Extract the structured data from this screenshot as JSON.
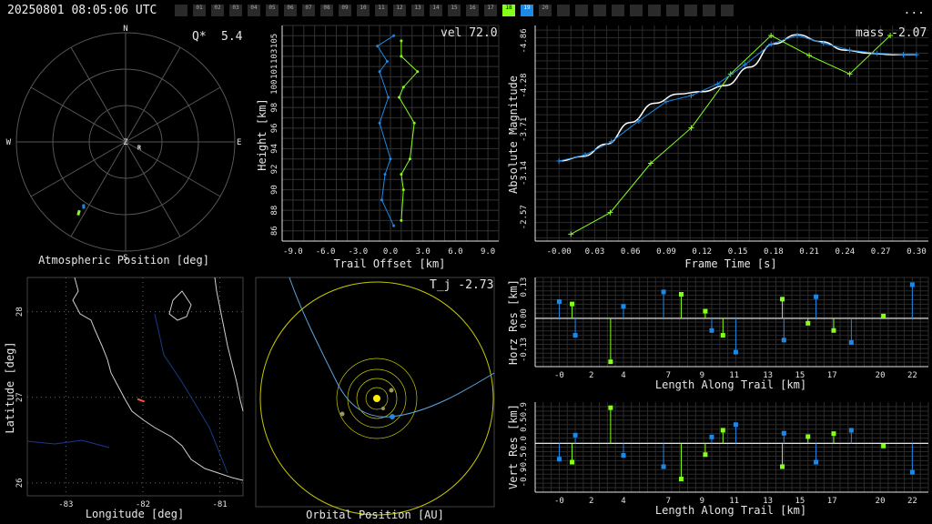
{
  "header": {
    "timestamp": "20250801 08:05:06 UTC",
    "cameras": [
      {
        "id": "",
        "state": "off"
      },
      {
        "id": "01",
        "state": "off"
      },
      {
        "id": "02",
        "state": "off"
      },
      {
        "id": "03",
        "state": "off"
      },
      {
        "id": "04",
        "state": "off"
      },
      {
        "id": "05",
        "state": "off"
      },
      {
        "id": "06",
        "state": "off"
      },
      {
        "id": "07",
        "state": "off"
      },
      {
        "id": "08",
        "state": "off"
      },
      {
        "id": "09",
        "state": "off"
      },
      {
        "id": "10",
        "state": "off"
      },
      {
        "id": "11",
        "state": "off"
      },
      {
        "id": "12",
        "state": "off"
      },
      {
        "id": "13",
        "state": "off"
      },
      {
        "id": "14",
        "state": "off"
      },
      {
        "id": "15",
        "state": "off"
      },
      {
        "id": "16",
        "state": "off"
      },
      {
        "id": "17",
        "state": "off"
      },
      {
        "id": "18",
        "state": "green"
      },
      {
        "id": "19",
        "state": "blue"
      },
      {
        "id": "20",
        "state": "off"
      },
      {
        "id": "",
        "state": "off"
      },
      {
        "id": "",
        "state": "off"
      },
      {
        "id": "",
        "state": "off"
      },
      {
        "id": "",
        "state": "off"
      },
      {
        "id": "",
        "state": "off"
      },
      {
        "id": "",
        "state": "off"
      },
      {
        "id": "",
        "state": "off"
      },
      {
        "id": "",
        "state": "off"
      },
      {
        "id": "",
        "state": "off"
      },
      {
        "id": "",
        "state": "off"
      }
    ],
    "menu_label": "..."
  },
  "colors": {
    "station1": "#86ff1a",
    "station2": "#1e88e5",
    "grid": "#555555",
    "axis": "#e6e6e6",
    "fit": "#ffffff",
    "orbit_ring": "#c8c800",
    "sun": "#ffee00"
  },
  "chart_data": [
    {
      "id": "polar",
      "type": "scatter",
      "title": "Atmospheric Position [deg]",
      "annotation_label": "Q*",
      "annotation_value": "5.4",
      "directions": [
        "N",
        "E",
        "S",
        "W",
        "Z"
      ],
      "radiant_label": "R",
      "radiant": {
        "az": 110,
        "zen": 12
      },
      "series": [
        {
          "station": 1,
          "points": [
            {
              "az": 213,
              "zen": 72
            },
            {
              "az": 214,
              "zen": 68
            }
          ]
        },
        {
          "station": 2,
          "points": [
            {
              "az": 212,
              "zen": 65
            },
            {
              "az": 214,
              "zen": 62
            }
          ]
        }
      ]
    },
    {
      "id": "trail",
      "type": "line",
      "annotation": "vel 72.0",
      "xlabel": "Trail Offset [km]",
      "ylabel": "Height [km]",
      "xlim": [
        -10,
        10
      ],
      "ylim": [
        85,
        106
      ],
      "xticks": [
        "-9.0",
        "-6.0",
        "-3.0",
        "0.0",
        "3.0",
        "6.0",
        "9.0"
      ],
      "yticks": [
        "86",
        "88",
        "90",
        "92",
        "94",
        "96",
        "98",
        "100",
        "101",
        "103",
        "105"
      ],
      "series": [
        {
          "station": 1,
          "x": [
            1.0,
            1.2,
            1.0,
            1.8,
            2.2,
            0.8,
            1.2,
            2.5,
            1.0,
            1.0
          ],
          "y": [
            87,
            90,
            91.5,
            93,
            96.5,
            99,
            100,
            101.5,
            103,
            104.5
          ]
        },
        {
          "station": 2,
          "x": [
            0.3,
            -0.8,
            -0.5,
            0.0,
            -1.0,
            -0.2,
            -1.0,
            -0.3,
            -1.2,
            0.3
          ],
          "y": [
            86.5,
            89,
            91.5,
            93,
            96.5,
            99,
            101.5,
            102.5,
            104,
            105
          ]
        }
      ]
    },
    {
      "id": "magnitude",
      "type": "line",
      "annotation": "mass -2.07",
      "xlabel": "Frame Time [s]",
      "ylabel": "Absolute Magnitude",
      "xlim": [
        -0.02,
        0.31
      ],
      "ylim": [
        -2.26,
        -5.06
      ],
      "xticks": [
        "-0.00",
        "0.03",
        "0.06",
        "0.09",
        "0.12",
        "0.15",
        "0.18",
        "0.21",
        "0.24",
        "0.27",
        "0.30"
      ],
      "yticks": [
        "-2.57",
        "-3.14",
        "-3.71",
        "-4.28",
        "-4.86"
      ],
      "series": [
        {
          "station": 1,
          "x": [
            0.01,
            0.043,
            0.077,
            0.111,
            0.144,
            0.178,
            0.21,
            0.244,
            0.278
          ],
          "y": [
            -2.35,
            -2.63,
            -3.27,
            -3.73,
            -4.43,
            -4.93,
            -4.67,
            -4.43,
            -4.93
          ]
        },
        {
          "station": 2,
          "x": [
            0.0,
            0.022,
            0.044,
            0.067,
            0.09,
            0.111,
            0.133,
            0.156,
            0.178,
            0.2,
            0.222,
            0.244,
            0.267,
            0.289,
            0.3
          ],
          "y": [
            -3.3,
            -3.38,
            -3.55,
            -3.82,
            -4.07,
            -4.15,
            -4.3,
            -4.55,
            -4.82,
            -4.93,
            -4.83,
            -4.74,
            -4.7,
            -4.68,
            -4.68
          ]
        }
      ],
      "fit": {
        "x": [
          0.0,
          0.02,
          0.04,
          0.06,
          0.08,
          0.1,
          0.12,
          0.14,
          0.16,
          0.18,
          0.2,
          0.22,
          0.24,
          0.26,
          0.28,
          0.3
        ],
        "y": [
          -3.3,
          -3.36,
          -3.52,
          -3.8,
          -4.05,
          -4.17,
          -4.2,
          -4.28,
          -4.52,
          -4.82,
          -4.94,
          -4.85,
          -4.74,
          -4.7,
          -4.68,
          -4.68
        ]
      }
    },
    {
      "id": "map",
      "type": "scatter",
      "xlabel": "Longitude [deg]",
      "ylabel": "Latitude [deg]",
      "xlim": [
        -83.5,
        -80.7
      ],
      "ylim": [
        25.85,
        28.4
      ],
      "xticks": [
        "-83",
        "-82",
        "-81"
      ],
      "yticks": [
        "26",
        "27",
        "28"
      ],
      "track": {
        "x": [
          -82.07,
          -81.98
        ],
        "y": [
          26.98,
          26.95
        ]
      }
    },
    {
      "id": "orbit",
      "type": "scatter",
      "title": "Orbital Position [AU]",
      "annotation": "T_j -2.73"
    },
    {
      "id": "horz_res",
      "type": "scatter",
      "xlabel": "Length Along Trail [km]",
      "ylabel": "Horz Res [km]",
      "xlim": [
        -1.5,
        23
      ],
      "ylim": [
        -0.2,
        0.17
      ],
      "xticks": [
        "-0",
        "2",
        "4",
        "7",
        "9",
        "11",
        "13",
        "15",
        "17",
        "20",
        "22"
      ],
      "yticks": [
        "-0.13",
        "0.00",
        "0.13"
      ],
      "series": [
        {
          "station": 1,
          "x": [
            0.8,
            3.2,
            7.6,
            9.1,
            10.2,
            13.9,
            15.5,
            17.1,
            20.2
          ],
          "y": [
            0.06,
            -0.18,
            0.1,
            0.03,
            -0.07,
            0.08,
            -0.02,
            -0.05,
            0.01
          ]
        },
        {
          "station": 2,
          "x": [
            -0.0,
            1.0,
            4.0,
            6.5,
            9.5,
            11.0,
            14.0,
            16.0,
            18.2,
            22.0
          ],
          "y": [
            0.07,
            -0.07,
            0.05,
            0.11,
            -0.05,
            -0.14,
            -0.09,
            0.09,
            -0.1,
            0.14
          ]
        }
      ]
    },
    {
      "id": "vert_res",
      "type": "scatter",
      "xlabel": "Length Along Trail [km]",
      "ylabel": "Vert Res [km]",
      "xlim": [
        -1.5,
        23
      ],
      "ylim": [
        -1.3,
        1.1
      ],
      "xticks": [
        "-0",
        "2",
        "4",
        "7",
        "9",
        "11",
        "13",
        "15",
        "17",
        "20",
        "22"
      ],
      "yticks": [
        "-0.9",
        "-0.5",
        "0.0",
        "0.5",
        "0.9"
      ],
      "series": [
        {
          "station": 1,
          "x": [
            0.8,
            3.2,
            7.6,
            9.1,
            10.2,
            13.9,
            15.5,
            17.1,
            20.2
          ],
          "y": [
            -0.5,
            0.95,
            -0.95,
            -0.3,
            0.35,
            -0.62,
            0.18,
            0.26,
            -0.07
          ]
        },
        {
          "station": 2,
          "x": [
            -0.0,
            1.0,
            4.0,
            6.5,
            9.5,
            11.0,
            14.0,
            16.0,
            18.2,
            22.0
          ],
          "y": [
            -0.42,
            0.22,
            -0.32,
            -0.62,
            0.17,
            0.5,
            0.27,
            -0.5,
            0.35,
            -0.77
          ]
        }
      ]
    }
  ]
}
